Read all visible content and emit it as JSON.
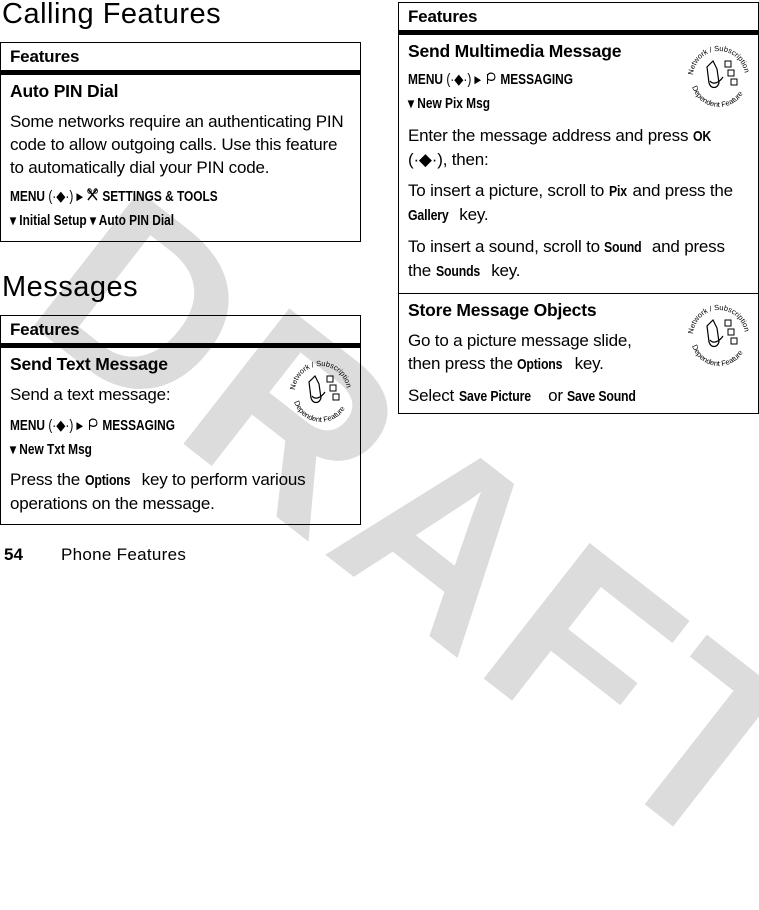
{
  "watermark": "DRAFT",
  "left_column": {
    "calling_title": "Calling Features",
    "calling_box": {
      "header": "Features",
      "feature": {
        "title": "Auto PIN Dial",
        "description": "Some networks require an authenticating PIN code to allow outgoing calls. Use this feature to automatically dial your PIN code.",
        "path_line1": {
          "menu": "MENU",
          "nav": "(·◆·)",
          "arrow": "▸",
          "icon": "settings-tools-icon",
          "target": "SETTINGS & TOOLS"
        },
        "path_line2": [
          "▾ Initial Setup",
          "▾ Auto PIN Dial"
        ]
      }
    },
    "messages_title": "Messages",
    "messages_box": {
      "header": "Features",
      "feature": {
        "title": "Send Text Message",
        "intro": "Send a text message:",
        "path_line1": {
          "menu": "MENU",
          "nav": "(·◆·)",
          "arrow": "▸",
          "icon": "messaging-icon",
          "target": "MESSAGING"
        },
        "path_line2": [
          "▾ New Txt Msg"
        ],
        "note_pre": "Press the ",
        "note_key": "Options",
        "note_post": " key to perform various operations on the message.",
        "badge": {
          "top": "Network / Subscription",
          "bottom": "Dependent Feature"
        }
      }
    }
  },
  "right_column": {
    "box": {
      "header": "Features",
      "feature1": {
        "title": "Send Multimedia Message",
        "path_line1": {
          "menu": "MENU",
          "nav": "(·◆·)",
          "arrow": "▸",
          "icon": "messaging-icon",
          "target": "MESSAGING"
        },
        "path_line2": [
          "▾ New Pix Msg"
        ],
        "step1_pre": "Enter the message address and press ",
        "step1_key": "OK",
        "step1_nav": " (·◆·)",
        "step1_post": ", then:",
        "step2_pre": "To insert a picture, scroll to ",
        "step2_key1": "Pix",
        "step2_mid": " and press the ",
        "step2_key2": "Gallery",
        "step2_post": " key.",
        "step3_pre": "To insert a sound, scroll to ",
        "step3_key1": "Sound",
        "step3_mid": " and press the ",
        "step3_key2": "Sounds",
        "step3_post": " key.",
        "badge": {
          "top": "Network / Subscription",
          "bottom": "Dependent Feature"
        }
      },
      "feature2": {
        "title": "Store Message Objects",
        "line1_pre": "Go to a picture message slide, then press the ",
        "line1_key": "Options",
        "line1_post": " key.",
        "line2_pre": "Select ",
        "line2_key1": "Save Picture",
        "line2_mid": " or ",
        "line2_key2": "Save Sound",
        "badge": {
          "top": "Network / Subscription",
          "bottom": "Dependent Feature"
        }
      }
    }
  },
  "footer": {
    "page_number": "54",
    "section": "Phone Features"
  }
}
